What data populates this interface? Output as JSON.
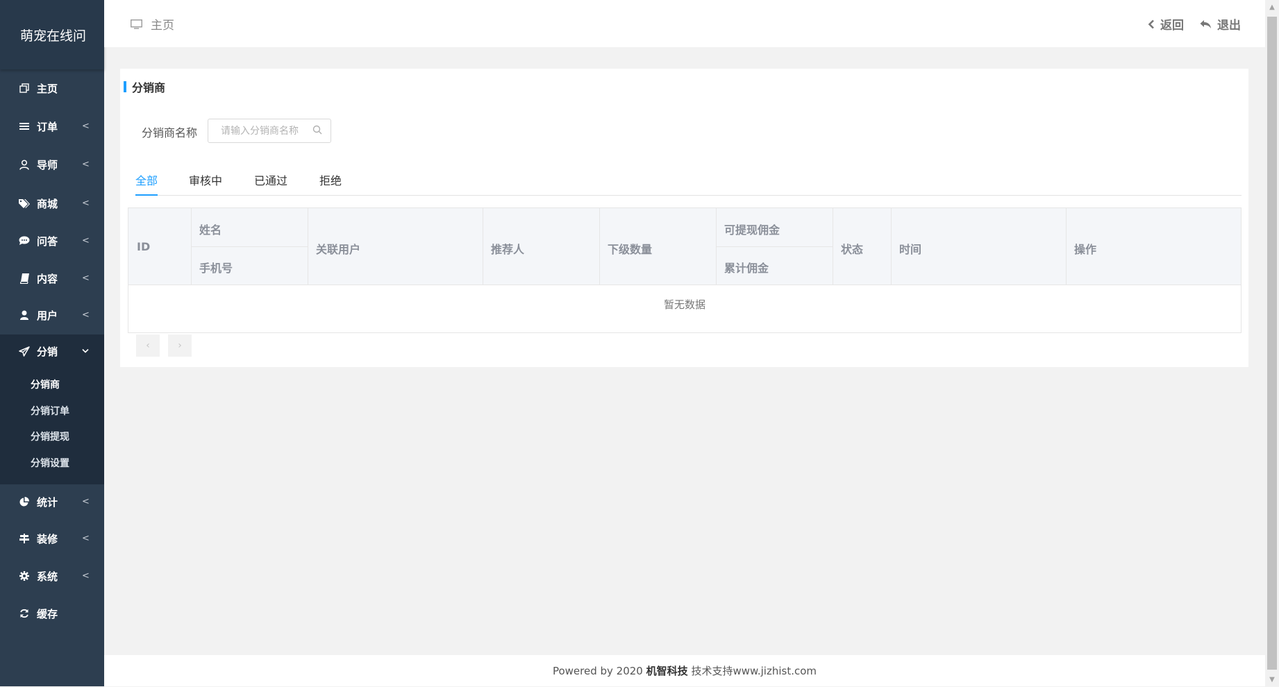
{
  "app": {
    "title": "萌宠在线问"
  },
  "sidebar": {
    "items": [
      {
        "label": "主页",
        "icon": "copy-icon",
        "has_caret": false
      },
      {
        "label": "订单",
        "icon": "list-icon",
        "has_caret": true
      },
      {
        "label": "导师",
        "icon": "user-icon",
        "has_caret": true
      },
      {
        "label": "商城",
        "icon": "tags-icon",
        "has_caret": true
      },
      {
        "label": "问答",
        "icon": "chat-icon",
        "has_caret": true
      },
      {
        "label": "内容",
        "icon": "book-icon",
        "has_caret": true
      },
      {
        "label": "用户",
        "icon": "person-icon",
        "has_caret": true
      },
      {
        "label": "分销",
        "icon": "paper-plane-icon",
        "has_caret": true,
        "expanded": true
      },
      {
        "label": "统计",
        "icon": "pie-chart-icon",
        "has_caret": true
      },
      {
        "label": "装修",
        "icon": "signpost-icon",
        "has_caret": true
      },
      {
        "label": "系统",
        "icon": "gear-icon",
        "has_caret": true
      },
      {
        "label": "缓存",
        "icon": "refresh-icon",
        "has_caret": false
      }
    ],
    "submenu": [
      {
        "label": "分销商",
        "active": true
      },
      {
        "label": "分销订单"
      },
      {
        "label": "分销提现"
      },
      {
        "label": "分销设置"
      }
    ]
  },
  "header": {
    "breadcrumb": "主页",
    "back_label": "返回",
    "logout_label": "退出"
  },
  "card": {
    "title": "分销商",
    "filter": {
      "label": "分销商名称",
      "placeholder": "请输入分销商名称",
      "value": ""
    },
    "tabs": [
      {
        "label": "全部",
        "active": true
      },
      {
        "label": "审核中"
      },
      {
        "label": "已通过"
      },
      {
        "label": "拒绝"
      }
    ],
    "table": {
      "headers": {
        "id": "ID",
        "name": "姓名",
        "phone": "手机号",
        "linked_user": "关联用户",
        "referrer": "推荐人",
        "subordinates": "下级数量",
        "withdrawable": "可提现佣金",
        "total": "累计佣金",
        "status": "状态",
        "time": "时间",
        "actions": "操作"
      },
      "rows": [],
      "empty_text": "暂无数据"
    },
    "pagination": {
      "prev": "‹",
      "next": "›"
    }
  },
  "footer": {
    "prefix": "Powered by 2020",
    "company": "机智科技",
    "suffix": "技术支持www.jizhist.com"
  },
  "colors": {
    "sidebar_bg": "#2d3e50",
    "accent": "#1e9fff",
    "page_bg": "#f2f2f2"
  }
}
